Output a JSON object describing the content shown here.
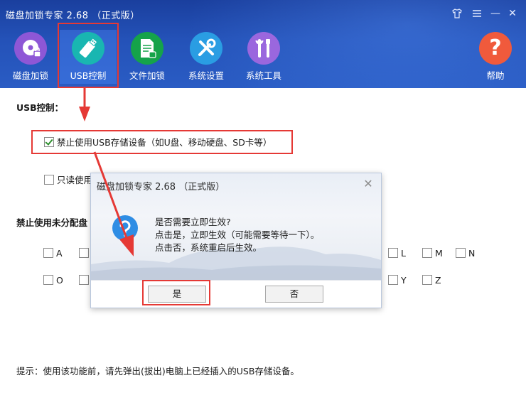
{
  "app": {
    "title": "磁盘加锁专家 2.68 （正式版）"
  },
  "window_controls": {
    "shirt_icon": "shirt-icon",
    "menu_icon": "menu-icon",
    "minimize": "—",
    "close": "✕"
  },
  "toolbar": {
    "items": [
      {
        "label": "磁盘加锁",
        "color": "#8e57d6"
      },
      {
        "label": "USB控制",
        "color": "#19b6b1"
      },
      {
        "label": "文件加锁",
        "color": "#15a34a"
      },
      {
        "label": "系统设置",
        "color": "#2a9de3"
      },
      {
        "label": "系统工具",
        "color": "#9a67de"
      },
      {
        "label": "帮助",
        "color": "#f05a3c"
      }
    ],
    "help_glyph": "?"
  },
  "usb": {
    "section_title": "USB控制：",
    "disable_usb_label": "禁止使用USB存储设备（如U盘、移动硬盘、SD卡等）",
    "disable_usb_checked": true,
    "readonly_label": "只读使用",
    "readonly_checked": false
  },
  "drives": {
    "section_title": "禁止使用未分配盘",
    "row1": [
      "A",
      "L",
      "M",
      "N"
    ],
    "row2": [
      "O",
      "Y",
      "Z"
    ]
  },
  "hint": "提示：使用该功能前，请先弹出(拔出)电脑上已经插入的USB存储设备。",
  "dialog": {
    "title": "磁盘加锁专家 2.68 （正式版）",
    "close": "✕",
    "lines": [
      "是否需要立即生效?",
      "点击是，立即生效（可能需要等待一下）。",
      "点击否，系统重启后生效。"
    ],
    "yes_label": "是",
    "no_label": "否"
  },
  "colors": {
    "highlight": "#e53935",
    "header": "#2452b8"
  }
}
